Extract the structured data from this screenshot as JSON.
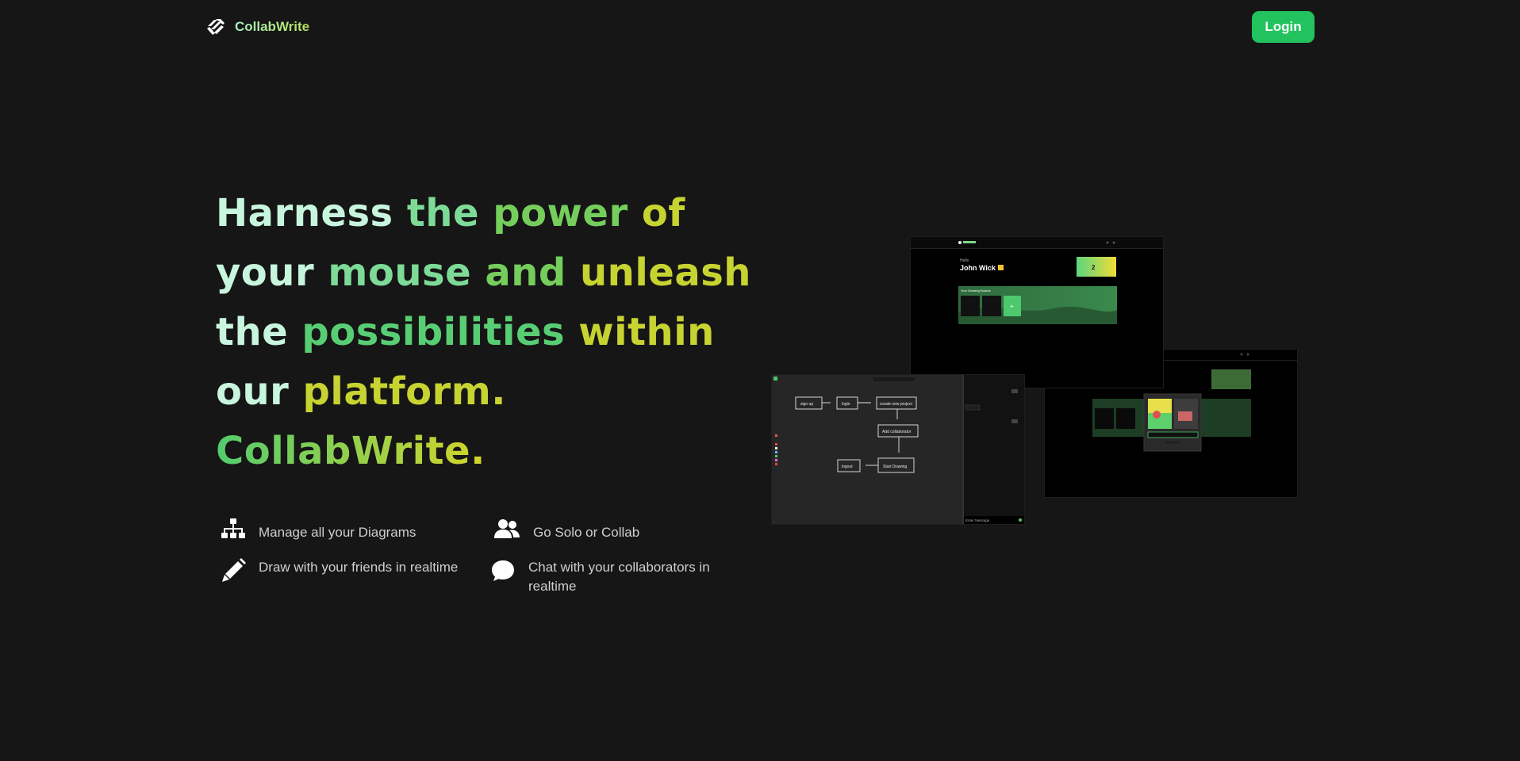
{
  "nav": {
    "brand": "CollabWrite",
    "login_label": "Login"
  },
  "hero": {
    "headline_lines": [
      [
        "Harness",
        "the",
        "power",
        "of"
      ],
      [
        "your",
        "mouse",
        "and",
        "unleash"
      ],
      [
        "the",
        "possibilities",
        "within"
      ],
      [
        "our",
        "platform."
      ],
      [
        "CollabWrite."
      ]
    ]
  },
  "features": [
    {
      "icon": "sitemap-icon",
      "text": "Manage all your Diagrams"
    },
    {
      "icon": "users-icon",
      "text": "Go Solo or Collab"
    },
    {
      "icon": "pencil-icon",
      "text": "Draw with your friends in realtime"
    },
    {
      "icon": "chat-bubble-icon",
      "text": "Chat with your collaborators in realtime"
    }
  ],
  "preview": {
    "dashboard_greeting": "Hello",
    "dashboard_user": "John Wick",
    "dashboard_section": "Your Drawing Boards",
    "stat_value": "2",
    "flow_nodes": [
      "sign up",
      "login",
      "create new project",
      "Add collaborator",
      "Start Drawing",
      "logout"
    ],
    "chat_placeholder": "Enter Message"
  },
  "colors": {
    "background": "#161616",
    "accent": "#22c35e",
    "gradient_start": "#c8f5dd",
    "gradient_mid": "#52cc6e",
    "gradient_end": "#d4d42a"
  }
}
